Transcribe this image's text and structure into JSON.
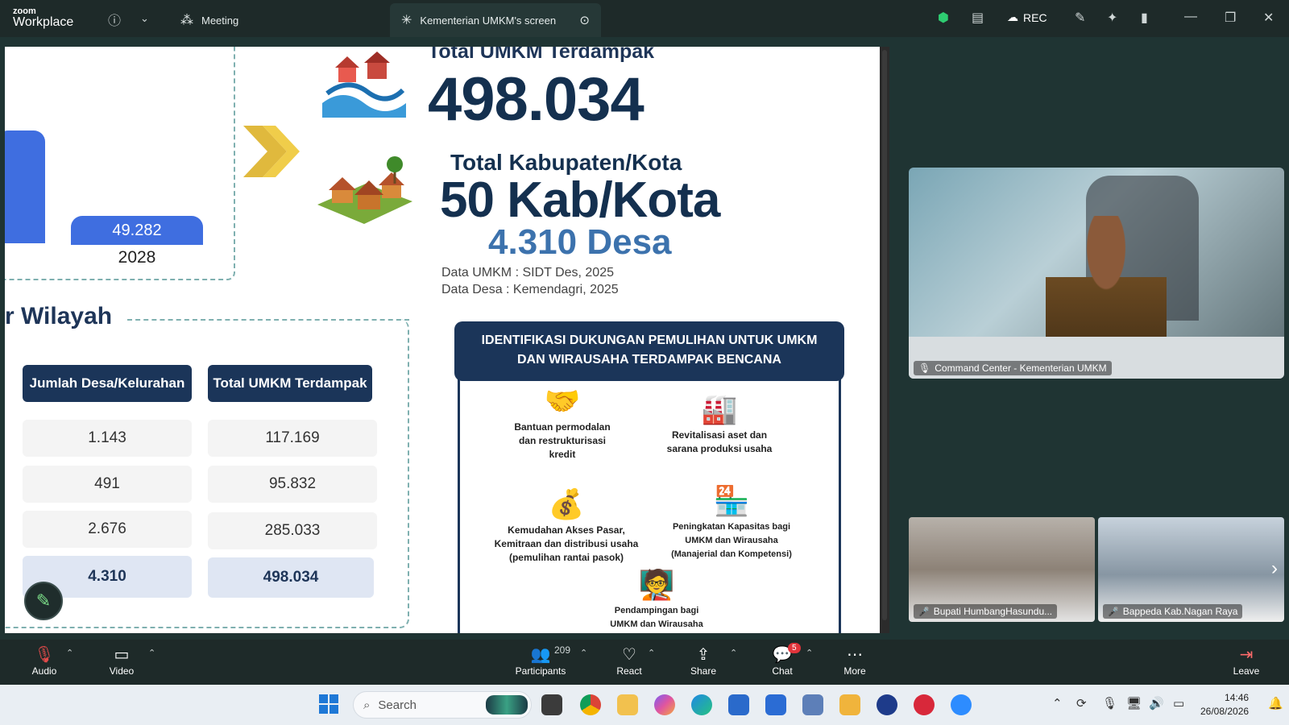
{
  "window": {
    "brand_top": "zoom",
    "brand_bottom": "Workplace",
    "meeting_tab": "Meeting",
    "share_tab": "Kementerian UMKM's screen",
    "rec_label": "REC"
  },
  "slide": {
    "bar_value": "49.282",
    "bar_year": "2028",
    "total_label": "Total UMKM Terdampak",
    "total_value": "498.034",
    "kab_label": "Total Kabupaten/Kota",
    "kab_value": "50 Kab/Kota",
    "desa_value": "4.310 Desa",
    "source_umkm": "Data UMKM : SIDT Des, 2025",
    "source_desa": "Data Desa : Kemendagri, 2025",
    "region_title": "r Wilayah",
    "table": {
      "col1_header": "Jumlah Desa/Kelurahan",
      "col2_header": "Total UMKM Terdampak",
      "rows": [
        {
          "desa": "1.143",
          "umkm": "117.169"
        },
        {
          "desa": "491",
          "umkm": "95.832"
        },
        {
          "desa": "2.676",
          "umkm": "285.033"
        }
      ],
      "total": {
        "desa": "4.310",
        "umkm": "498.034"
      }
    },
    "ident_title": "IDENTIFIKASI DUKUNGAN PEMULIHAN UNTUK UMKM DAN WIRAUSAHA TERDAMPAK BENCANA",
    "support_items": [
      "Bantuan permodalan dan restrukturisasi kredit",
      "Revitalisasi aset dan sarana produksi usaha",
      "Kemudahan Akses Pasar, Kemitraan dan distribusi usaha (pemulihan rantai pasok)",
      "Peningkatan Kapasitas bagi UMKM dan Wirausaha (Manajerial dan Kompetensi)",
      "Pendampingan bagi UMKM dan Wirausaha"
    ]
  },
  "videos": {
    "main_label": "Command Center - Kementerian UMKM",
    "tile1_label": "Bupati HumbangHasundu...",
    "tile2_label": "Bappeda Kab.Nagan Raya"
  },
  "toolbar": {
    "audio": "Audio",
    "video": "Video",
    "participants": "Participants",
    "participant_count": "209",
    "react": "React",
    "share": "Share",
    "chat": "Chat",
    "chat_badge": "5",
    "more": "More",
    "leave": "Leave"
  },
  "taskbar": {
    "search_placeholder": "Search",
    "time": "14:46",
    "date": "26/08/2026"
  },
  "colors": {
    "slide_navy": "#1b3559",
    "bar_blue": "#3f6ee0",
    "desa_blue": "#3c72ad",
    "zoom_bg": "#1e2a29",
    "security_green": "#2ecc71",
    "muted_red": "#e34a4a"
  },
  "icons": [
    "info-icon",
    "chevron-down-icon",
    "meeting-icon",
    "share-screen-icon",
    "more-options-icon",
    "shield-icon",
    "notes-icon",
    "cloud-rec-icon",
    "annotate-icon",
    "ai-companion-icon",
    "layout-icon",
    "minimize-icon",
    "restore-icon",
    "close-icon",
    "pencil-icon",
    "mic-muted-icon",
    "camera-icon",
    "participants-icon",
    "react-icon",
    "share-icon",
    "chat-icon",
    "more-icon",
    "leave-icon"
  ]
}
